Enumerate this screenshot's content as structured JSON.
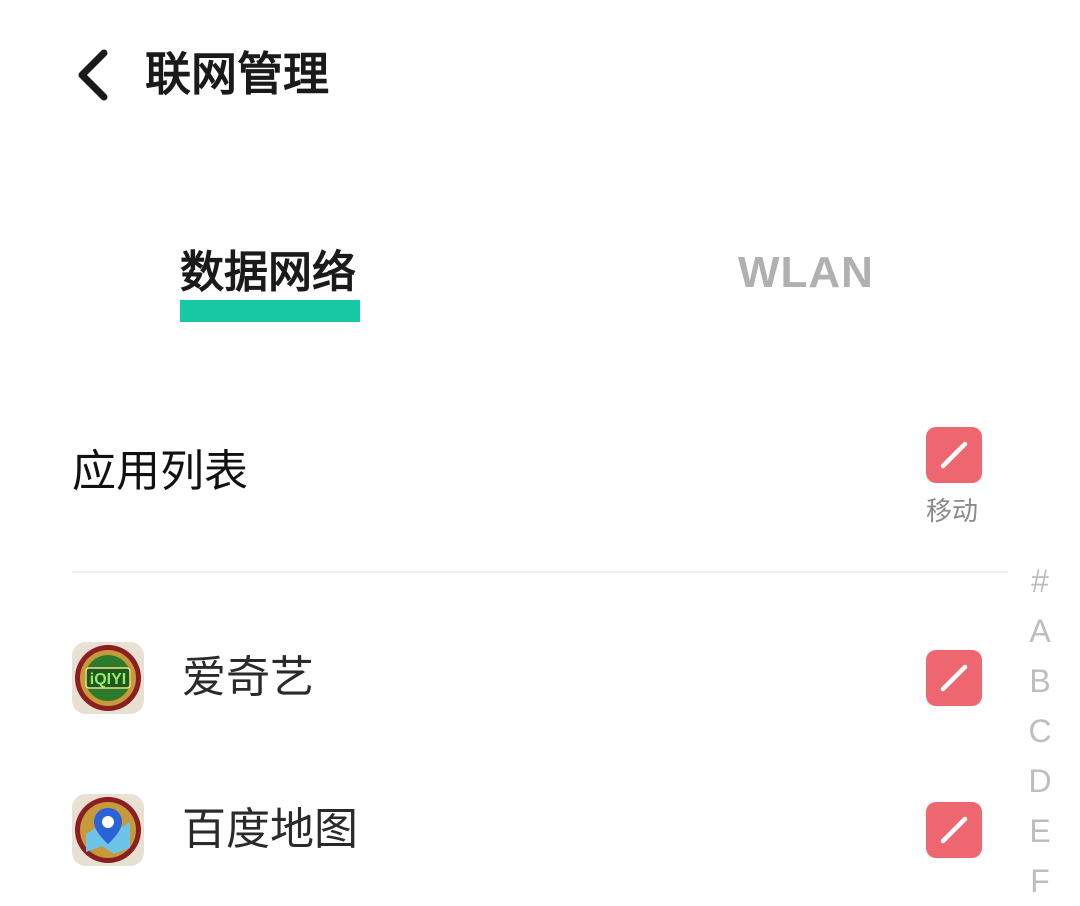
{
  "header": {
    "title": "联网管理",
    "back_icon": "chevron-left-icon"
  },
  "tabs": [
    {
      "label": "数据网络",
      "active": true
    },
    {
      "label": "WLAN",
      "active": false
    }
  ],
  "colors": {
    "accent": "#17c8a4",
    "toggle_on": "#ee6670",
    "inactive_text": "#b0b0b0"
  },
  "section": {
    "title": "应用列表",
    "toggle_caption": "移动",
    "toggle_icon": "slash-icon"
  },
  "apps": [
    {
      "name": "爱奇艺",
      "icon": "iqiyi-app-icon",
      "icon_text": "iQIYI"
    },
    {
      "name": "百度地图",
      "icon": "baidu-map-app-icon"
    }
  ],
  "alpha_index": [
    "#",
    "A",
    "B",
    "C",
    "D",
    "E",
    "F"
  ]
}
